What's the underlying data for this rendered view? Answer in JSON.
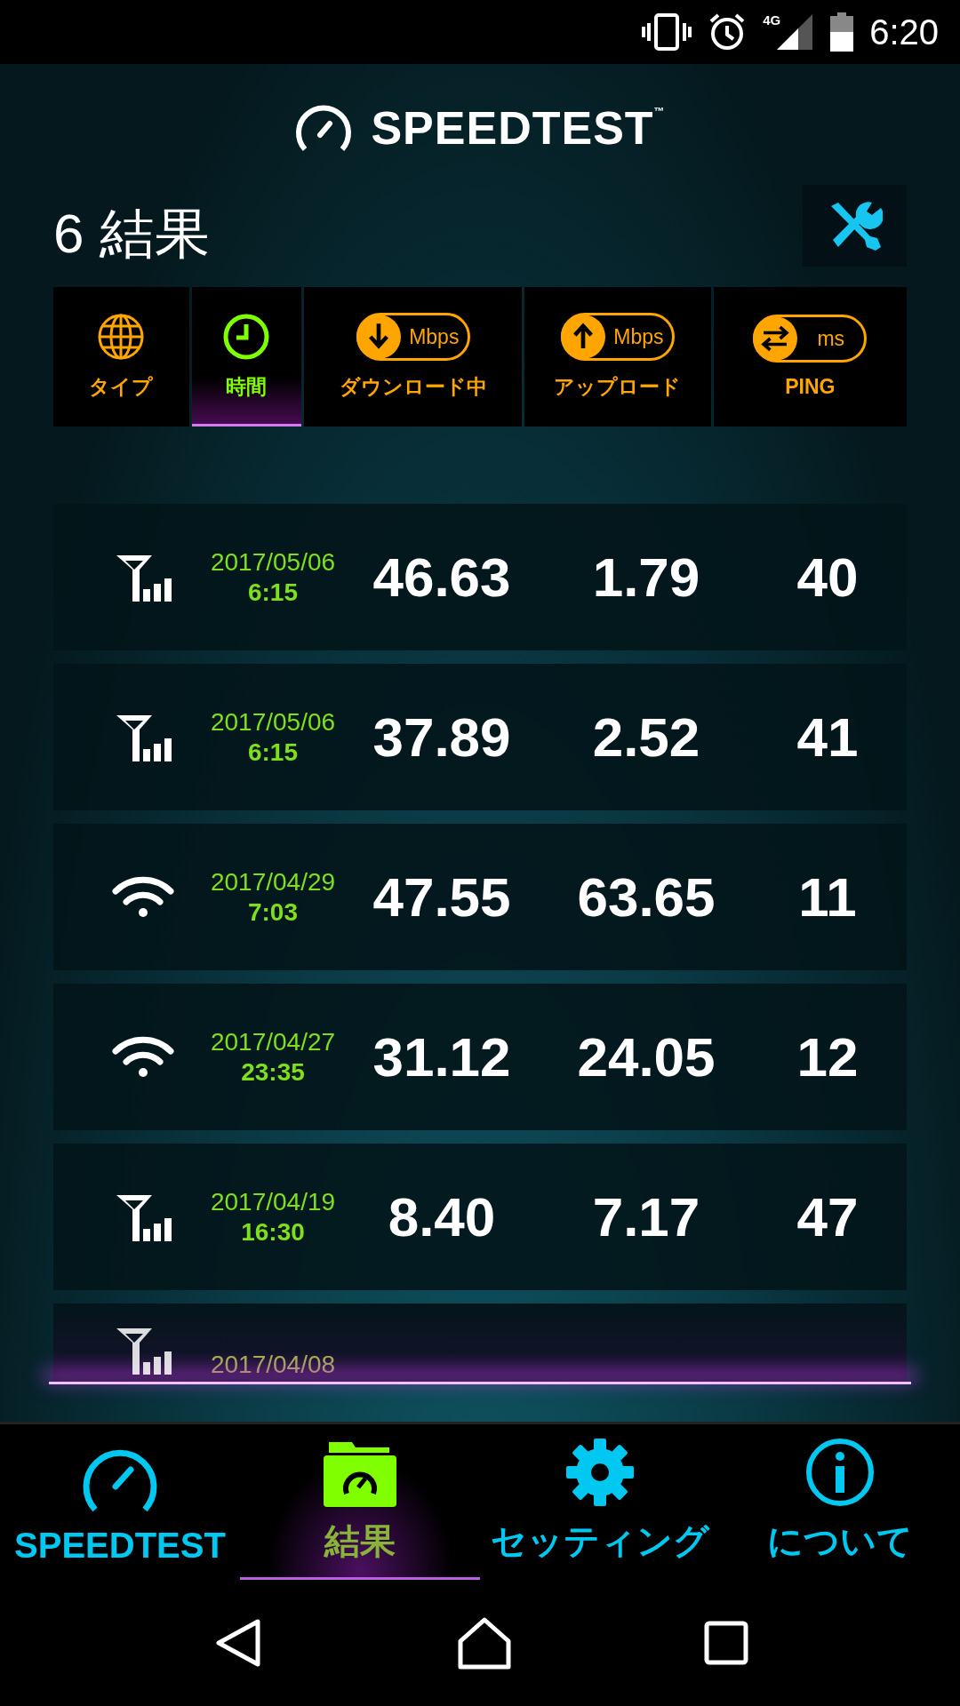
{
  "status_bar": {
    "network": "4G",
    "time": "6:20"
  },
  "header": {
    "logo": "SPEEDTEST",
    "trademark": "™"
  },
  "results_title": "6 結果",
  "sort_tabs": [
    {
      "kind": "globe",
      "label": "タイプ",
      "selected": false
    },
    {
      "kind": "clock",
      "label": "時間",
      "selected": true
    },
    {
      "kind": "download",
      "unit": "Mbps",
      "label": "ダウンロード中",
      "selected": false
    },
    {
      "kind": "upload",
      "unit": "Mbps",
      "label": "アップロード",
      "selected": false
    },
    {
      "kind": "ping",
      "unit": "ms",
      "label": "PING",
      "selected": false
    }
  ],
  "results": [
    {
      "kind": "cellular",
      "date": "2017/05/06",
      "time": "6:15",
      "download": "46.63",
      "upload": "1.79",
      "ping": "40"
    },
    {
      "kind": "cellular",
      "date": "2017/05/06",
      "time": "6:15",
      "download": "37.89",
      "upload": "2.52",
      "ping": "41"
    },
    {
      "kind": "wifi",
      "date": "2017/04/29",
      "time": "7:03",
      "download": "47.55",
      "upload": "63.65",
      "ping": "11"
    },
    {
      "kind": "wifi",
      "date": "2017/04/27",
      "time": "23:35",
      "download": "31.12",
      "upload": "24.05",
      "ping": "12"
    },
    {
      "kind": "cellular",
      "date": "2017/04/19",
      "time": "16:30",
      "download": "8.40",
      "upload": "7.17",
      "ping": "47"
    },
    {
      "kind": "cellular",
      "date": "2017/04/08"
    }
  ],
  "bottom_nav": [
    {
      "kind": "speedtest",
      "label": "SPEEDTEST",
      "selected": false
    },
    {
      "kind": "results",
      "label": "結果",
      "selected": true
    },
    {
      "kind": "settings",
      "label": "セッティング",
      "selected": false
    },
    {
      "kind": "about",
      "label": "について",
      "selected": false
    }
  ]
}
